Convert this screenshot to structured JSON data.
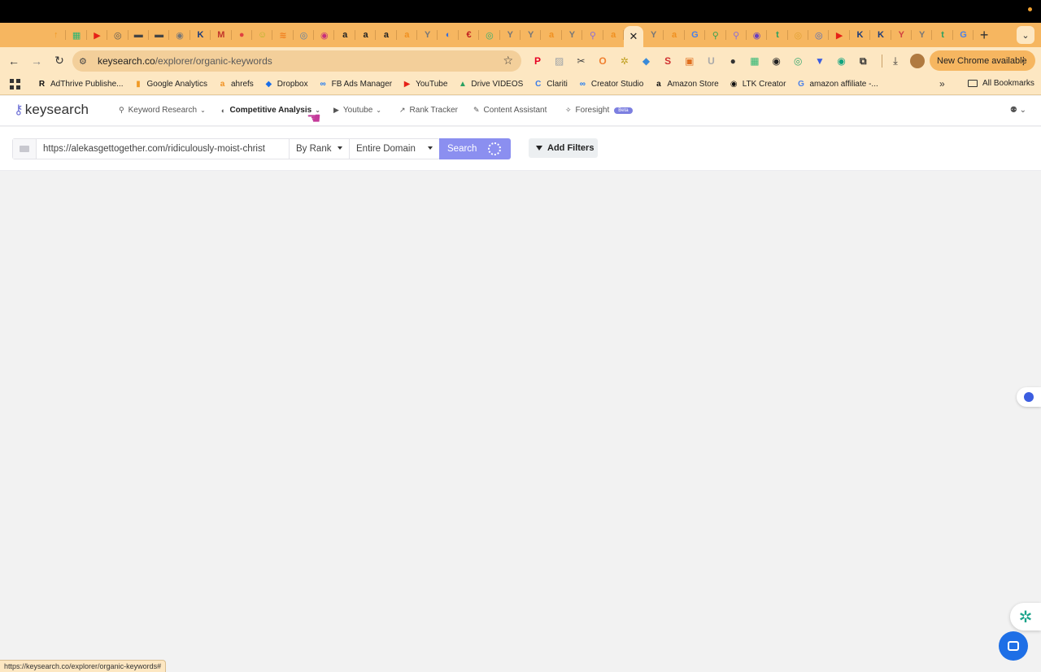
{
  "browser": {
    "tab_favicons": [
      {
        "glyph": "↑",
        "color": "#f09a25"
      },
      {
        "glyph": "▦",
        "color": "#2bb673"
      },
      {
        "glyph": "▶",
        "color": "#e62117"
      },
      {
        "glyph": "◎",
        "color": "#555555"
      },
      {
        "glyph": "▬",
        "color": "#444444"
      },
      {
        "glyph": "▬",
        "color": "#444444"
      },
      {
        "glyph": "◉",
        "color": "#777777"
      },
      {
        "glyph": "K",
        "color": "#1a3b7a"
      },
      {
        "glyph": "M",
        "color": "#c1352a"
      },
      {
        "glyph": "●",
        "color": "#e04040"
      },
      {
        "glyph": "☺",
        "color": "#b5b52a"
      },
      {
        "glyph": "≋",
        "color": "#f08020"
      },
      {
        "glyph": "◎",
        "color": "#5b7fa6"
      },
      {
        "glyph": "◉",
        "color": "#c8307a"
      },
      {
        "glyph": "a",
        "color": "#222222"
      },
      {
        "glyph": "a",
        "color": "#222222"
      },
      {
        "glyph": "a",
        "color": "#222222"
      },
      {
        "glyph": "a",
        "color": "#f09020"
      },
      {
        "glyph": "Y",
        "color": "#777777"
      },
      {
        "glyph": "◐",
        "color": "#3a6fd8"
      },
      {
        "glyph": "€",
        "color": "#c02020"
      },
      {
        "glyph": "◎",
        "color": "#38b070"
      },
      {
        "glyph": "Y",
        "color": "#777777"
      },
      {
        "glyph": "Y",
        "color": "#777777"
      },
      {
        "glyph": "a",
        "color": "#f09020"
      },
      {
        "glyph": "Y",
        "color": "#777777"
      },
      {
        "glyph": "⚲",
        "color": "#8a6fd8"
      },
      {
        "glyph": "a",
        "color": "#f09020"
      }
    ],
    "tab_favicons_after": [
      {
        "glyph": "Y",
        "color": "#777777"
      },
      {
        "glyph": "a",
        "color": "#f09020"
      },
      {
        "glyph": "G",
        "color": "#4a80e8"
      },
      {
        "glyph": "⚲",
        "color": "#38a050"
      },
      {
        "glyph": "⚲",
        "color": "#8a6fd8"
      },
      {
        "glyph": "◉",
        "color": "#6a40c0"
      },
      {
        "glyph": "t",
        "color": "#2aa060"
      },
      {
        "glyph": "◎",
        "color": "#e0a030"
      },
      {
        "glyph": "◎",
        "color": "#4a6ac0"
      },
      {
        "glyph": "▶",
        "color": "#e62117"
      },
      {
        "glyph": "K",
        "color": "#1a3b7a"
      },
      {
        "glyph": "K",
        "color": "#1a3b7a"
      },
      {
        "glyph": "Y",
        "color": "#d04040"
      },
      {
        "glyph": "Y",
        "color": "#777777"
      },
      {
        "glyph": "t",
        "color": "#2aa060"
      },
      {
        "glyph": "G",
        "color": "#4a80e8"
      }
    ],
    "active_tab_close": "✕",
    "new_tab": "+",
    "address": {
      "domain": "keysearch.co",
      "path": "/explorer/organic-keywords"
    },
    "extensions": [
      {
        "glyph": "P",
        "color": "#e60023"
      },
      {
        "glyph": "▨",
        "color": "#9aa0a6"
      },
      {
        "glyph": "✂",
        "color": "#444444"
      },
      {
        "glyph": "O",
        "color": "#f08030"
      },
      {
        "glyph": "✲",
        "color": "#c0a020"
      },
      {
        "glyph": "◆",
        "color": "#3a8ad8"
      },
      {
        "glyph": "S",
        "color": "#d03030"
      },
      {
        "glyph": "▣",
        "color": "#e07020"
      },
      {
        "glyph": "U",
        "color": "#aaaaaa"
      },
      {
        "glyph": "●",
        "color": "#333333"
      },
      {
        "glyph": "▦",
        "color": "#2bb673"
      },
      {
        "glyph": "◉",
        "color": "#222222"
      },
      {
        "glyph": "◎",
        "color": "#38a870"
      },
      {
        "glyph": "▼",
        "color": "#3b5de0"
      },
      {
        "glyph": "◉",
        "color": "#10a37f"
      },
      {
        "glyph": "⧉",
        "color": "#333333"
      }
    ],
    "update_button": "New Chrome available",
    "bookmarks": [
      {
        "label": "AdThrive Publishe...",
        "glyph": "R",
        "color": "#111111"
      },
      {
        "label": "Google Analytics",
        "glyph": "▮",
        "color": "#f09a25"
      },
      {
        "label": "ahrefs",
        "glyph": "a",
        "color": "#f09020"
      },
      {
        "label": "Dropbox",
        "glyph": "◆",
        "color": "#1a6ee8"
      },
      {
        "label": "FB Ads Manager",
        "glyph": "∞",
        "color": "#1877f2"
      },
      {
        "label": "YouTube",
        "glyph": "▶",
        "color": "#e62117"
      },
      {
        "label": "Drive VIDEOS",
        "glyph": "▲",
        "color": "#2aa060"
      },
      {
        "label": "Clariti",
        "glyph": "C",
        "color": "#3a7ae8"
      },
      {
        "label": "Creator Studio",
        "glyph": "∞",
        "color": "#1877f2"
      },
      {
        "label": "Amazon Store",
        "glyph": "a",
        "color": "#111111"
      },
      {
        "label": "LTK Creator",
        "glyph": "◉",
        "color": "#111111"
      },
      {
        "label": "amazon affiliate -...",
        "glyph": "G",
        "color": "#4a80e8"
      }
    ],
    "bookmarks_more": "»",
    "all_bookmarks": "All Bookmarks",
    "status_url": "https://keysearch.co/explorer/organic-keywords#"
  },
  "app": {
    "logo": "keysearch",
    "nav": [
      {
        "label": "Keyword Research",
        "icon": "⚲",
        "chevron": "⌄"
      },
      {
        "label": "Competitive Analysis",
        "icon": "◐",
        "chevron": "⌄"
      },
      {
        "label": "Youtube",
        "icon": "▶",
        "chevron": "⌄"
      },
      {
        "label": "Rank Tracker",
        "icon": "↗"
      },
      {
        "label": "Content Assistant",
        "icon": "✎"
      },
      {
        "label": "Foresight",
        "icon": "✧",
        "badge": "Beta"
      }
    ],
    "user_menu": "⚉ ⌄",
    "search": {
      "url_value": "https://alekasgettogether.com/ridiculously-moist-christ",
      "rank_select": "By Rank",
      "domain_select": "Entire Domain",
      "button": "Search",
      "filters_button": "Add Filters"
    }
  },
  "colors": {
    "accent": "#8b8ff0",
    "tabstrip": "#f6b660",
    "toolbar": "#fde7c2"
  }
}
